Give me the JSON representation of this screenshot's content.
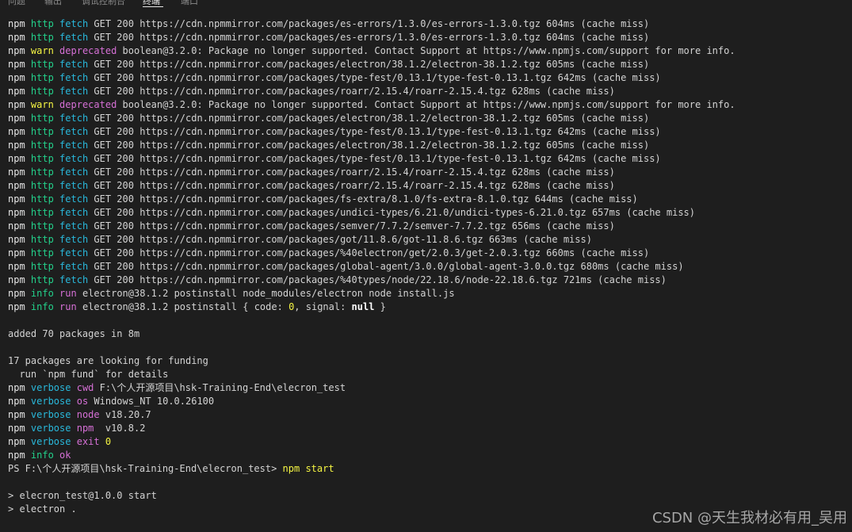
{
  "tabs": [
    {
      "label": "问题"
    },
    {
      "label": "输出"
    },
    {
      "label": "调试控制台"
    },
    {
      "label": "终端"
    },
    {
      "label": "端口"
    }
  ],
  "active_tab": "终端",
  "colors": {
    "background": "#1e1e1e",
    "http_green": "#23d18b",
    "fetch_cyan": "#29b8db",
    "warn_magenta": "#d670d6",
    "number_yellow": "#f5f543"
  },
  "lines": [
    {
      "level": "http",
      "kind": "fetch",
      "text": "GET 200 https://cdn.npmmirror.com/packages/es-errors/1.3.0/es-errors-1.3.0.tgz 604ms (cache miss)"
    },
    {
      "level": "http",
      "kind": "fetch",
      "text": "GET 200 https://cdn.npmmirror.com/packages/es-errors/1.3.0/es-errors-1.3.0.tgz 604ms (cache miss)"
    },
    {
      "level": "warn",
      "kind": "deprecated",
      "text": "boolean@3.2.0: Package no longer supported. Contact Support at https://www.npmjs.com/support for more info."
    },
    {
      "level": "http",
      "kind": "fetch",
      "text": "GET 200 https://cdn.npmmirror.com/packages/electron/38.1.2/electron-38.1.2.tgz 605ms (cache miss)"
    },
    {
      "level": "http",
      "kind": "fetch",
      "text": "GET 200 https://cdn.npmmirror.com/packages/type-fest/0.13.1/type-fest-0.13.1.tgz 642ms (cache miss)"
    },
    {
      "level": "http",
      "kind": "fetch",
      "text": "GET 200 https://cdn.npmmirror.com/packages/roarr/2.15.4/roarr-2.15.4.tgz 628ms (cache miss)"
    },
    {
      "level": "warn",
      "kind": "deprecated",
      "text": "boolean@3.2.0: Package no longer supported. Contact Support at https://www.npmjs.com/support for more info."
    },
    {
      "level": "http",
      "kind": "fetch",
      "text": "GET 200 https://cdn.npmmirror.com/packages/electron/38.1.2/electron-38.1.2.tgz 605ms (cache miss)"
    },
    {
      "level": "http",
      "kind": "fetch",
      "text": "GET 200 https://cdn.npmmirror.com/packages/type-fest/0.13.1/type-fest-0.13.1.tgz 642ms (cache miss)"
    },
    {
      "level": "http",
      "kind": "fetch",
      "text": "GET 200 https://cdn.npmmirror.com/packages/electron/38.1.2/electron-38.1.2.tgz 605ms (cache miss)"
    },
    {
      "level": "http",
      "kind": "fetch",
      "text": "GET 200 https://cdn.npmmirror.com/packages/type-fest/0.13.1/type-fest-0.13.1.tgz 642ms (cache miss)"
    },
    {
      "level": "http",
      "kind": "fetch",
      "text": "GET 200 https://cdn.npmmirror.com/packages/roarr/2.15.4/roarr-2.15.4.tgz 628ms (cache miss)"
    },
    {
      "level": "http",
      "kind": "fetch",
      "text": "GET 200 https://cdn.npmmirror.com/packages/roarr/2.15.4/roarr-2.15.4.tgz 628ms (cache miss)"
    },
    {
      "level": "http",
      "kind": "fetch",
      "text": "GET 200 https://cdn.npmmirror.com/packages/fs-extra/8.1.0/fs-extra-8.1.0.tgz 644ms (cache miss)"
    },
    {
      "level": "http",
      "kind": "fetch",
      "text": "GET 200 https://cdn.npmmirror.com/packages/undici-types/6.21.0/undici-types-6.21.0.tgz 657ms (cache miss)"
    },
    {
      "level": "http",
      "kind": "fetch",
      "text": "GET 200 https://cdn.npmmirror.com/packages/semver/7.7.2/semver-7.7.2.tgz 656ms (cache miss)"
    },
    {
      "level": "http",
      "kind": "fetch",
      "text": "GET 200 https://cdn.npmmirror.com/packages/got/11.8.6/got-11.8.6.tgz 663ms (cache miss)"
    },
    {
      "level": "http",
      "kind": "fetch",
      "text": "GET 200 https://cdn.npmmirror.com/packages/%40electron/get/2.0.3/get-2.0.3.tgz 660ms (cache miss)"
    },
    {
      "level": "http",
      "kind": "fetch",
      "text": "GET 200 https://cdn.npmmirror.com/packages/global-agent/3.0.0/global-agent-3.0.0.tgz 680ms (cache miss)"
    },
    {
      "level": "http",
      "kind": "fetch",
      "text": "GET 200 https://cdn.npmmirror.com/packages/%40types/node/22.18.6/node-22.18.6.tgz 721ms (cache miss)"
    },
    {
      "level": "info",
      "kind": "run",
      "text": "electron@38.1.2 postinstall node_modules/electron node install.js"
    },
    {
      "level": "info",
      "kind": "run",
      "text": "electron@38.1.2 postinstall { code: ",
      "code": "0",
      "mid": ", signal: ",
      "signal": "null",
      "tail": " }"
    },
    {
      "plain": ""
    },
    {
      "plain": "added 70 packages in 8m"
    },
    {
      "plain": ""
    },
    {
      "plain": "17 packages are looking for funding"
    },
    {
      "plain": "  run `npm fund` for details"
    },
    {
      "level": "verbose",
      "kind": "cwd",
      "text": "F:\\个人开源项目\\hsk-Training-End\\elecron_test"
    },
    {
      "level": "verbose",
      "kind": "os",
      "text": "Windows_NT 10.0.26100"
    },
    {
      "level": "verbose",
      "kind": "node",
      "text": "v18.20.7"
    },
    {
      "level": "verbose",
      "kind": "npm ",
      "text": "v10.8.2"
    },
    {
      "level": "verbose",
      "kind": "exit",
      "num": "0"
    },
    {
      "level": "info",
      "kind": "ok",
      "text": ""
    },
    {
      "prompt": "PS F:\\个人开源项目\\hsk-Training-End\\elecron_test> ",
      "cmd": "npm start"
    },
    {
      "plain": ""
    },
    {
      "plain": "> elecron_test@1.0.0 start"
    },
    {
      "plain": "> electron ."
    }
  ],
  "watermark": "CSDN @天生我材必有用_吴用"
}
